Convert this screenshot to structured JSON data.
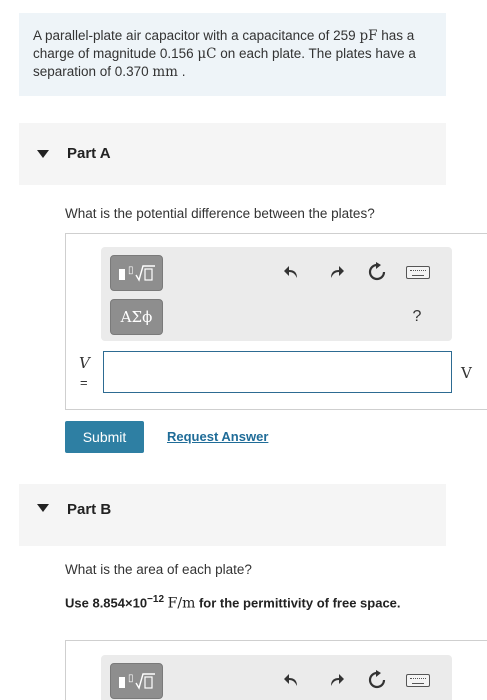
{
  "problem": {
    "p1": "A parallel-plate air capacitor with a capacitance of 259 ",
    "u1": "pF",
    "p2": " has a charge of magnitude 0.156 ",
    "u2": "μC",
    "p3": " on each plate. The plates have a separation of 0.370 ",
    "u3": "mm",
    "p4": " ."
  },
  "part_a": {
    "title": "Part A",
    "question": "What is the potential difference between the plates?",
    "var_label": "V",
    "equals": "=",
    "unit": "V",
    "input_value": "",
    "submit_label": "Submit",
    "request_label": "Request Answer"
  },
  "toolbar": {
    "template_icon": "math-template-icon",
    "greek_label": "ΑΣϕ",
    "help_label": "?",
    "icons": [
      "undo-icon",
      "redo-icon",
      "reset-icon",
      "keyboard-icon"
    ]
  },
  "part_b": {
    "title": "Part B",
    "question": "What is the area of each plate?",
    "given_use": "Use 8.854×10",
    "given_exp": "−12",
    "given_unit": "F/m",
    "given_rest": " for the permittivity of free space."
  }
}
